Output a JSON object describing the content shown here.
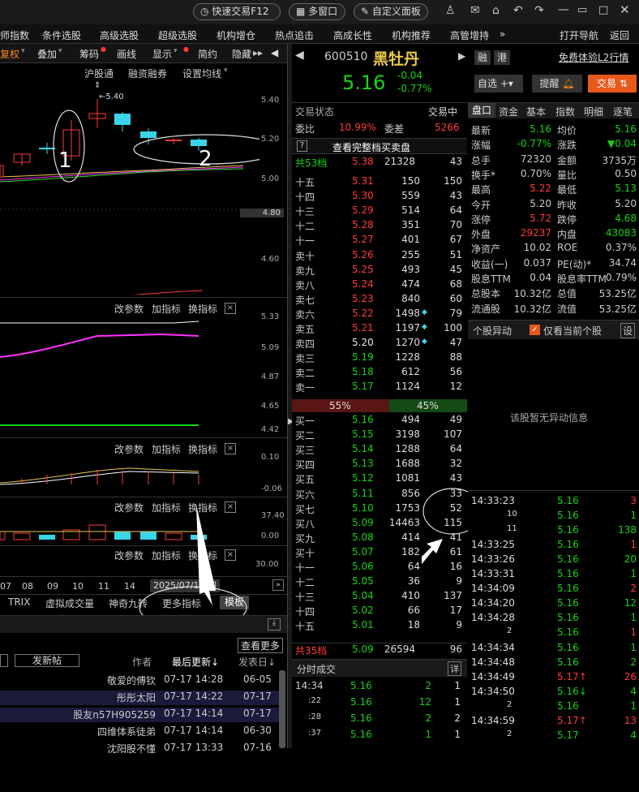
{
  "topbar": {
    "quick_trade": "快速交易F12",
    "multi_window": "多窗口",
    "custom_panel": "自定义面板"
  },
  "menu": [
    "师指数",
    "条件选股",
    "高级选股",
    "超级选股",
    "机构增仓",
    "热点追击",
    "高成长性",
    "机构推荐",
    "高管增持",
    "»",
    "打开导航",
    "返回"
  ],
  "chart_toolbar": [
    "复权",
    "叠加",
    "筹码",
    "画线",
    "显示",
    "简约",
    "隐藏"
  ],
  "chart_links": {
    "hgt": "沪股通",
    "rzrq": "融资融券",
    "set_ma": "设置均线"
  },
  "kline": {
    "high_label": "5.40",
    "annotation_1": "1",
    "annotation_2": "2",
    "y_ticks": [
      "5.40",
      "5.20",
      "5.00",
      "4.80",
      "4.60"
    ],
    "cursor_price": "4.80"
  },
  "sub_controls": {
    "mod": "改参数",
    "add": "加指标",
    "swap": "换指标",
    "close": "×"
  },
  "sub1_ticks": [
    "5.33",
    "5.09",
    "4.87",
    "4.65",
    "4.42"
  ],
  "sub2_ticks": [
    "0.10",
    "-0.06"
  ],
  "sub3_ticks": [
    "37.40",
    "0.00"
  ],
  "sub4_ticks": [
    "30.00"
  ],
  "x_dates": [
    "07",
    "08",
    "09",
    "10",
    "11",
    "14"
  ],
  "date_box": "2025/07/17/四",
  "bottom_tabs": [
    "TRIX",
    "虚拟成交量",
    "神奇九转",
    "更多指标",
    "模板"
  ],
  "forum": {
    "view_more": "查看更多",
    "new_post": "发新帖",
    "author": "作者",
    "last_update": "最后更新↓",
    "posted": "发表日↓",
    "posts": [
      {
        "author": "敬爱的傅钦",
        "update": "07-17 14:28",
        "date": "06-05"
      },
      {
        "author": "彤彤太阳",
        "update": "07-17 14:22",
        "date": "07-17"
      },
      {
        "author": "股友n57H905259",
        "update": "07-17 14:14",
        "date": "07-17"
      },
      {
        "author": "四维体系徒弟",
        "update": "07-17 14:14",
        "date": "06-30"
      },
      {
        "author": "沈阳股不懂",
        "update": "07-17 13:33",
        "date": "07-16"
      }
    ]
  },
  "stock": {
    "code": "600510",
    "name": "黑牡丹",
    "price": "5.16",
    "change": "-0.04",
    "pct": "-0.77%",
    "tag1": "融",
    "tag2": "港",
    "l2": "免费体验L2行情",
    "zixuan": "自选",
    "remind": "提醒",
    "trade": "交易"
  },
  "orderbook": {
    "status_label": "交易状态",
    "status": "交易中",
    "wb_label": "委比",
    "wb": "10.99%",
    "wc_label": "委差",
    "wc": "5266",
    "full": "查看完整档买卖盘",
    "sell_total": {
      "label": "共53档",
      "price": "5.38",
      "vol": "21328",
      "n": "43"
    },
    "sells": [
      [
        "十五",
        "5.31",
        "150",
        "150"
      ],
      [
        "十四",
        "5.30",
        "559",
        "43"
      ],
      [
        "十三",
        "5.29",
        "514",
        "64"
      ],
      [
        "十二",
        "5.28",
        "351",
        "70"
      ],
      [
        "十一",
        "5.27",
        "401",
        "67"
      ],
      [
        "卖十",
        "5.26",
        "255",
        "51"
      ],
      [
        "卖九",
        "5.25",
        "493",
        "45"
      ],
      [
        "卖八",
        "5.24",
        "474",
        "68"
      ],
      [
        "卖七",
        "5.23",
        "840",
        "60"
      ],
      [
        "卖六",
        "5.22",
        "1498",
        "79"
      ],
      [
        "卖五",
        "5.21",
        "1197",
        "100"
      ],
      [
        "卖四",
        "5.20",
        "1270",
        "47"
      ],
      [
        "卖三",
        "5.19",
        "1228",
        "88"
      ],
      [
        "卖二",
        "5.18",
        "612",
        "56"
      ],
      [
        "卖一",
        "5.17",
        "1124",
        "12"
      ]
    ],
    "ratio_sell": "55%",
    "ratio_buy": "45%",
    "buys": [
      [
        "买一",
        "5.16",
        "494",
        "49"
      ],
      [
        "买二",
        "5.15",
        "3198",
        "107"
      ],
      [
        "买三",
        "5.14",
        "1288",
        "64"
      ],
      [
        "买四",
        "5.13",
        "1688",
        "32"
      ],
      [
        "买五",
        "5.12",
        "1081",
        "43"
      ],
      [
        "买六",
        "5.11",
        "856",
        "33"
      ],
      [
        "买七",
        "5.10",
        "1753",
        "52"
      ],
      [
        "买八",
        "5.09",
        "14463",
        "115"
      ],
      [
        "买九",
        "5.08",
        "414",
        "41"
      ],
      [
        "买十",
        "5.07",
        "182",
        "61"
      ],
      [
        "十一",
        "5.06",
        "64",
        "16"
      ],
      [
        "十二",
        "5.05",
        "36",
        "9"
      ],
      [
        "十三",
        "5.04",
        "410",
        "137"
      ],
      [
        "十四",
        "5.02",
        "66",
        "17"
      ],
      [
        "十五",
        "5.01",
        "18",
        "9"
      ]
    ],
    "buy_total": {
      "label": "共35档",
      "price": "5.09",
      "vol": "26594",
      "n": "96"
    }
  },
  "fenshi": {
    "title": "分时成交",
    "detail": "详",
    "rows": [
      [
        "14:34",
        "5.16",
        "2",
        "1"
      ],
      [
        ":22",
        "5.16",
        "12",
        "1"
      ],
      [
        ":28",
        "5.16",
        "2",
        "2"
      ],
      [
        ":37",
        "5.16",
        "1",
        "1"
      ]
    ]
  },
  "quote_tabs": [
    "盘口",
    "资金",
    "基本",
    "指数",
    "明细",
    "逐笔"
  ],
  "quote": [
    [
      "最新",
      "5.16",
      "均价",
      "5.16"
    ],
    [
      "涨幅",
      "-0.77%",
      "涨跌",
      "▼0.04"
    ],
    [
      "总手",
      "72320",
      "金额",
      "3735万"
    ],
    [
      "换手*",
      "0.70%",
      "量比",
      "0.50"
    ],
    [
      "最高",
      "5.22",
      "最低",
      "5.13"
    ],
    [
      "今开",
      "5.20",
      "昨收",
      "5.20"
    ],
    [
      "涨停",
      "5.72",
      "跌停",
      "4.68"
    ],
    [
      "外盘",
      "29237",
      "内盘",
      "43083"
    ],
    [
      "净资产",
      "10.02",
      "ROE",
      "0.37%"
    ],
    [
      "收益(一)",
      "0.037",
      "PE(动)*",
      "34.74"
    ],
    [
      "股息TTM",
      "0.04",
      "股息率TTM",
      "0.79%"
    ],
    [
      "总股本",
      "10.32亿",
      "总值",
      "53.25亿"
    ],
    [
      "流通股",
      "10.32亿",
      "流值",
      "53.25亿"
    ]
  ],
  "anomaly": {
    "title": "个股异动",
    "only_current": "仅看当前个股",
    "settings": "设",
    "empty": "该股暂无异动信息"
  },
  "ticks": [
    [
      "14:33:23",
      "5.16",
      "3"
    ],
    [
      "10",
      "5.16",
      "1"
    ],
    [
      "11",
      "5.16",
      "138"
    ],
    [
      "14:33:25",
      "5.16",
      "1"
    ],
    [
      "14:33:26",
      "5.16",
      "20"
    ],
    [
      "14:33:31",
      "5.16",
      "1"
    ],
    [
      "14:34:09",
      "5.16",
      "2"
    ],
    [
      "14:34:20",
      "5.16",
      "12"
    ],
    [
      "14:34:28",
      "5.16",
      "1"
    ],
    [
      "2",
      "5.16",
      "1"
    ],
    [
      "14:34:34",
      "5.16",
      "1"
    ],
    [
      "14:34:48",
      "5.16",
      "2"
    ],
    [
      "14:34:49",
      "5.17↑",
      "26"
    ],
    [
      "14:34:50",
      "5.16↓",
      "4"
    ],
    [
      "2",
      "5.16",
      "1"
    ],
    [
      "14:34:59",
      "5.17↑",
      "13"
    ],
    [
      "2",
      "5.17",
      "4"
    ]
  ],
  "colors": {
    "up": "#ff3b3b",
    "down": "#16d416",
    "cyan": "#39d5e8"
  }
}
